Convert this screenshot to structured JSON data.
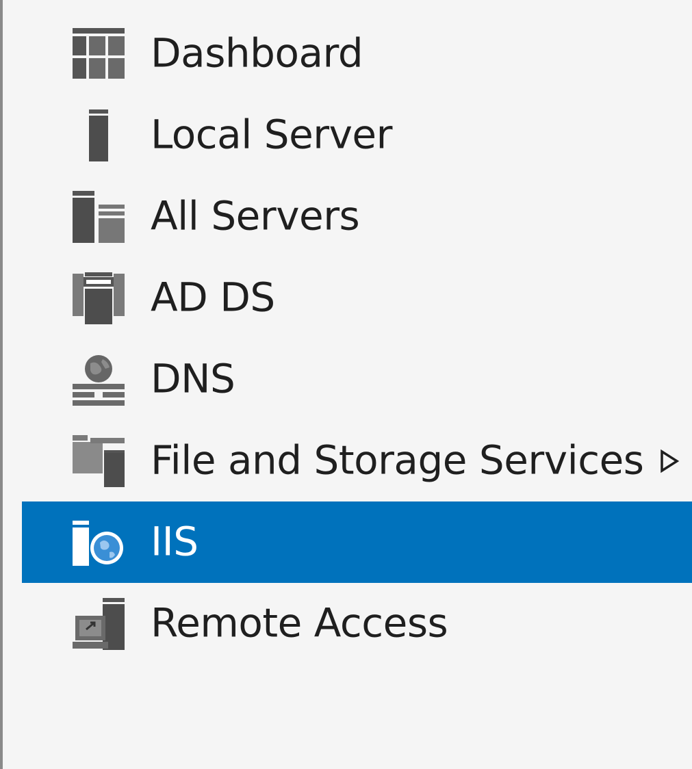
{
  "nav": {
    "items": [
      {
        "label": "Dashboard",
        "icon": "dashboard-icon",
        "selected": false
      },
      {
        "label": "Local Server",
        "icon": "local-server-icon",
        "selected": false
      },
      {
        "label": "All Servers",
        "icon": "all-servers-icon",
        "selected": false
      },
      {
        "label": "AD DS",
        "icon": "ad-ds-icon",
        "selected": false
      },
      {
        "label": "DNS",
        "icon": "dns-icon",
        "selected": false
      },
      {
        "label": "File and Storage Services",
        "icon": "file-storage-icon",
        "selected": false,
        "expandable": true,
        "expand_icon": "expand-arrow-icon"
      },
      {
        "label": "IIS",
        "icon": "iis-icon",
        "selected": true
      },
      {
        "label": "Remote Access",
        "icon": "remote-access-icon",
        "selected": false
      }
    ]
  },
  "colors": {
    "selection_background": "#0072bc",
    "pane_background": "#f5f5f5",
    "label_text": "#1f1f1f",
    "selected_label_text": "#ffffff",
    "icon_gray": "#555555",
    "icon_globe_blue": "#3a8fd6"
  }
}
